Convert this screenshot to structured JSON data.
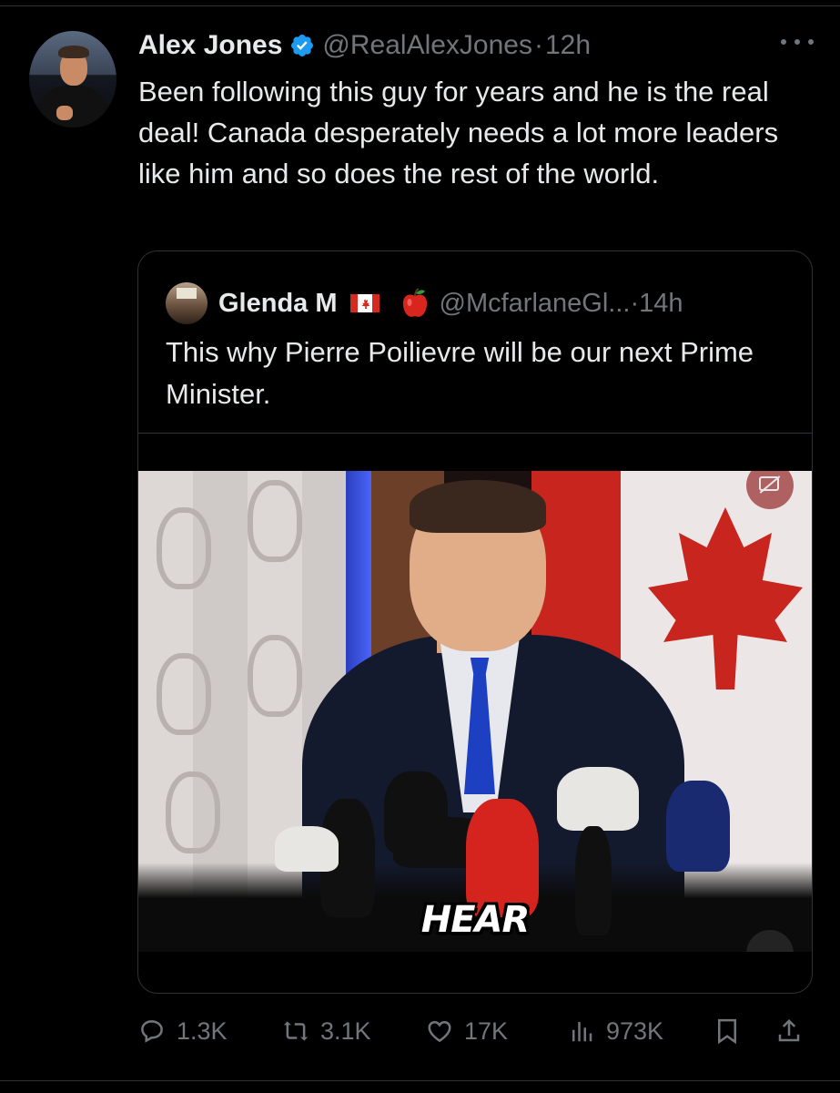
{
  "post": {
    "author": {
      "name": "Alex Jones",
      "handle": "@RealAlexJones",
      "separator": "·",
      "time": "12h"
    },
    "text": "Been following this guy for years and he is the real deal! Canada desperately needs a lot more leaders like him and so does the rest of the world.",
    "icons": {
      "verified": "verified-badge-icon",
      "more": "more-icon"
    },
    "colors": {
      "verified": "#1d9bf0",
      "muted": "#71767b",
      "text": "#e7e9ea",
      "background": "#000000"
    }
  },
  "quote": {
    "author": {
      "name": "Glenda M",
      "emoji_flag": "canada-flag-icon",
      "emoji_apple": "apple-icon",
      "handle": "@McfarlaneGl...",
      "separator": "·",
      "time": "14h"
    },
    "text": "This why Pierre Poilievre will be our next Prime Minister.",
    "video": {
      "caption": "HEAR",
      "icons": {
        "captions": "captions-off-icon",
        "volume": "volume-muted-icon"
      }
    }
  },
  "actions": {
    "replies": "1.3K",
    "reposts": "3.1K",
    "likes": "17K",
    "views": "973K",
    "icons": [
      "reply-icon",
      "repost-icon",
      "like-icon",
      "views-icon",
      "bookmark-icon",
      "share-icon"
    ]
  }
}
